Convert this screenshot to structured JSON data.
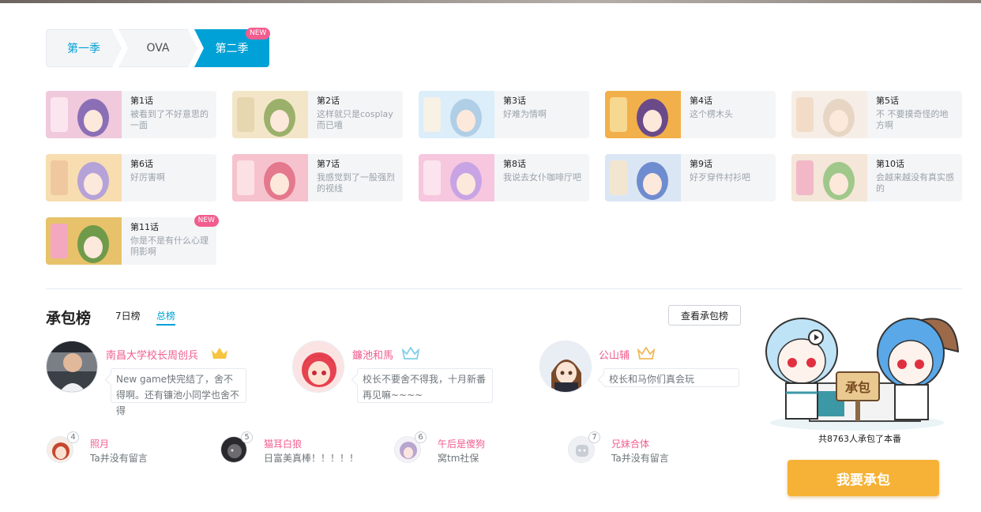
{
  "seasons": {
    "tabs": [
      {
        "label": "第一季"
      },
      {
        "label": "OVA"
      },
      {
        "label": "第二季"
      }
    ],
    "active_badge": "NEW"
  },
  "episodes": [
    {
      "num": "第1话",
      "title": "被看到了不好意思的一面"
    },
    {
      "num": "第2话",
      "title": "这样就只是cosplay而已嘻"
    },
    {
      "num": "第3话",
      "title": "好难为情啊"
    },
    {
      "num": "第4话",
      "title": "这个楞木头"
    },
    {
      "num": "第5话",
      "title": "不 不要摸奇怪的地方啊"
    },
    {
      "num": "第6话",
      "title": "好厉害啊"
    },
    {
      "num": "第7话",
      "title": "我感觉到了一股强烈的视线"
    },
    {
      "num": "第8话",
      "title": "我说去女仆咖啡厅吧"
    },
    {
      "num": "第9话",
      "title": "好歹穿件村衫吧"
    },
    {
      "num": "第10话",
      "title": "会越来越没有真实感的"
    },
    {
      "num": "第11话",
      "title": "你是不是有什么心理阴影啊",
      "badge": "NEW"
    }
  ],
  "ranking": {
    "title": "承包榜",
    "tab_week": "7日榜",
    "tab_total": "总榜",
    "view_button": "查看承包榜",
    "top": [
      {
        "name": "南昌大学校长周创兵",
        "message": "New game快完结了，舍不得啊。还有镰池小同学也舍不得",
        "crown_color": "#f6c440"
      },
      {
        "name": "鐮池和馬",
        "message": "校长不要舍不得我，十月新番再见嘛~~~~",
        "crown_color": "#7fcfea"
      },
      {
        "name": "公山辅",
        "message": "校长和马你们真会玩",
        "crown_color": "#f0b85a"
      }
    ],
    "others": [
      {
        "rank": "4",
        "name": "照月",
        "message": "Ta并没有留言"
      },
      {
        "rank": "5",
        "name": "猫耳白狼",
        "message": "日富美真棒！！！！！"
      },
      {
        "rank": "6",
        "name": "午后是傻狗",
        "message": "窝tm社保"
      },
      {
        "rank": "7",
        "name": "兄妹合体",
        "message": "Ta并没有留言"
      }
    ]
  },
  "sponsor": {
    "sign": "承包",
    "count_text": "共8763人承包了本番",
    "button": "我要承包"
  }
}
